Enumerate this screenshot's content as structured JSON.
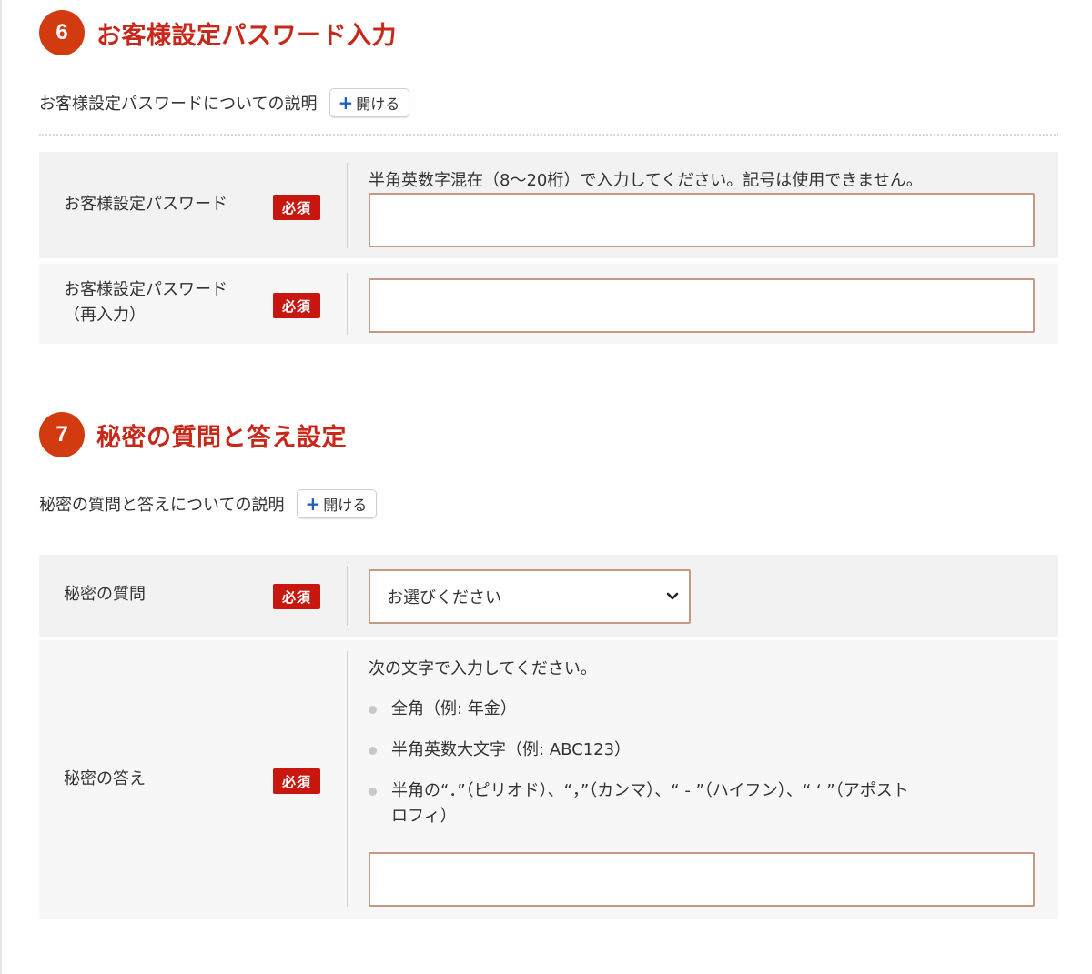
{
  "section6": {
    "number": "6",
    "title": "お客様設定パスワード入力",
    "explain_label": "お客様設定パスワードについての説明",
    "open_label": "開ける",
    "password": {
      "label": "お客様設定パスワード",
      "required": "必須",
      "hint": "半角英数字混在（8～20桁）で入力してください。記号は使用できません。",
      "value": ""
    },
    "password_confirm": {
      "label_line1": "お客様設定パスワード",
      "label_line2": "（再入力）",
      "required": "必須",
      "value": ""
    }
  },
  "section7": {
    "number": "7",
    "title": "秘密の質問と答え設定",
    "explain_label": "秘密の質問と答えについての説明",
    "open_label": "開ける",
    "question": {
      "label": "秘密の質問",
      "required": "必須",
      "selected": "お選びください"
    },
    "answer": {
      "label": "秘密の答え",
      "required": "必須",
      "intro": "次の文字で入力してください。",
      "rules": [
        "全角（例: 年金）",
        "半角英数大文字（例: ABC123）"
      ],
      "rule3_line1": "半角の“．”（ピリオド）、“，”（カンマ）、“ - ”（ハイフン）、“ ‘ ”（アポスト",
      "rule3_line2": "ロフィ）",
      "value": ""
    }
  }
}
